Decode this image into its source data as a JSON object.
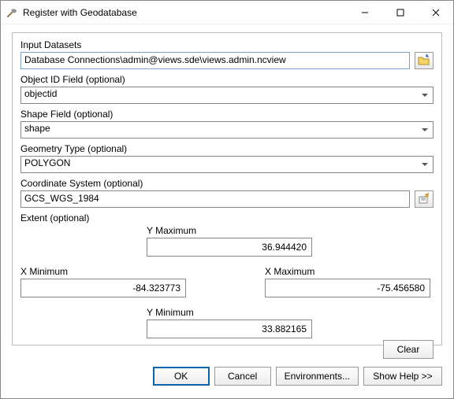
{
  "window": {
    "title": "Register with Geodatabase"
  },
  "labels": {
    "input_datasets": "Input Datasets",
    "object_id": "Object ID Field (optional)",
    "shape_field": "Shape Field (optional)",
    "geometry_type": "Geometry Type (optional)",
    "coord_sys": "Coordinate System (optional)",
    "extent": "Extent (optional)",
    "y_max": "Y Maximum",
    "x_min": "X Minimum",
    "x_max": "X Maximum",
    "y_min": "Y Minimum"
  },
  "values": {
    "input_datasets": "Database Connections\\admin@views.sde\\views.admin.ncview",
    "object_id": "objectid",
    "shape_field": "shape",
    "geometry_type": "POLYGON",
    "coord_sys": "GCS_WGS_1984",
    "y_max": "36.944420",
    "x_min": "-84.323773",
    "x_max": "-75.456580",
    "y_min": "33.882165"
  },
  "buttons": {
    "clear": "Clear",
    "ok": "OK",
    "cancel": "Cancel",
    "environments": "Environments...",
    "show_help": "Show Help >>"
  }
}
